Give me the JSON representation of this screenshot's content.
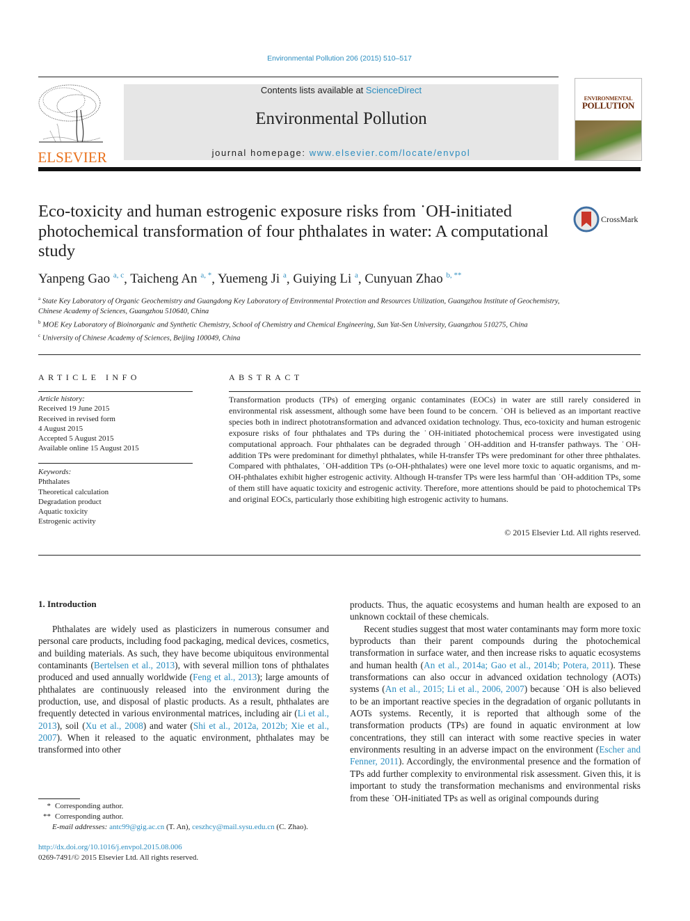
{
  "header": {
    "citation": "Environmental Pollution 206 (2015) 510–517",
    "contents_prefix": "Contents lists available at ",
    "contents_link": "ScienceDirect",
    "journal_title": "Environmental Pollution",
    "homepage_prefix": "journal homepage: ",
    "homepage_link": "www.elsevier.com/locate/envpol",
    "publisher_logo_text": "ELSEVIER",
    "cover_title_line1": "ENVIRONMENTAL",
    "cover_title_line2": "POLLUTION"
  },
  "article": {
    "title": "Eco-toxicity and human estrogenic exposure risks from ˙OH-initiated photochemical transformation of four phthalates in water: A computational study",
    "crossmark_label": "CrossMark",
    "authors": [
      {
        "name": "Yanpeng Gao",
        "sup": "a, c"
      },
      {
        "name": "Taicheng An",
        "sup": "a, *"
      },
      {
        "name": "Yuemeng Ji",
        "sup": "a"
      },
      {
        "name": "Guiying Li",
        "sup": "a"
      },
      {
        "name": "Cunyuan Zhao",
        "sup": "b, **"
      }
    ],
    "affiliations": [
      {
        "mark": "a",
        "text": "State Key Laboratory of Organic Geochemistry and Guangdong Key Laboratory of Environmental Protection and Resources Utilization, Guangzhou Institute of Geochemistry, Chinese Academy of Sciences, Guangzhou 510640, China"
      },
      {
        "mark": "b",
        "text": "MOE Key Laboratory of Bioinorganic and Synthetic Chemistry, School of Chemistry and Chemical Engineering, Sun Yat-Sen University, Guangzhou 510275, China"
      },
      {
        "mark": "c",
        "text": "University of Chinese Academy of Sciences, Beijing 100049, China"
      }
    ]
  },
  "article_info": {
    "heading": "ARTICLE INFO",
    "history_label": "Article history:",
    "history": [
      "Received 19 June 2015",
      "Received in revised form",
      "4 August 2015",
      "Accepted 5 August 2015",
      "Available online 15 August 2015"
    ],
    "keywords_label": "Keywords:",
    "keywords": [
      "Phthalates",
      "Theoretical calculation",
      "Degradation product",
      "Aquatic toxicity",
      "Estrogenic activity"
    ]
  },
  "abstract": {
    "heading": "ABSTRACT",
    "text": "Transformation products (TPs) of emerging organic contaminates (EOCs) in water are still rarely considered in environmental risk assessment, although some have been found to be concern. ˙OH is believed as an important reactive species both in indirect phototransformation and advanced oxidation technology. Thus, eco-toxicity and human estrogenic exposure risks of four phthalates and TPs during the ˙OH-initiated photochemical process were investigated using computational approach. Four phthalates can be degraded through ˙OH-addition and H-transfer pathways. The ˙OH-addition TPs were predominant for dimethyl phthalates, while H-transfer TPs were predominant for other three phthalates. Compared with phthalates, ˙OH-addition TPs (o-OH-phthalates) were one level more toxic to aquatic organisms, and m-OH-phthalates exhibit higher estrogenic activity. Although H-transfer TPs were less harmful than ˙OH-addition TPs, some of them still have aquatic toxicity and estrogenic activity. Therefore, more attentions should be paid to photochemical TPs and original EOCs, particularly those exhibiting high estrogenic activity to humans.",
    "copyright": "© 2015 Elsevier Ltd. All rights reserved."
  },
  "intro": {
    "heading": "1.  Introduction",
    "left_p1": [
      {
        "t": "Phthalates are widely used as plasticizers in numerous consumer and personal care products, including food packaging, medical devices, cosmetics, and building materials. As such, they have become ubiquitous environmental contaminants ("
      },
      {
        "l": "Bertelsen et al., 2013"
      },
      {
        "t": "), with several million tons of phthalates produced and used annually worldwide ("
      },
      {
        "l": "Feng et al., 2013"
      },
      {
        "t": "); large amounts of phthalates are continuously released into the environment during the production, use, and disposal of plastic products. As a result, phthalates are frequently detected in various environmental matrices, including air ("
      },
      {
        "l": "Li et al., 2013"
      },
      {
        "t": "), soil ("
      },
      {
        "l": "Xu et al., 2008"
      },
      {
        "t": ") and water ("
      },
      {
        "l": "Shi et al., 2012a, 2012b; Xie et al., 2007"
      },
      {
        "t": "). When it released to the aquatic environment, phthalates may be transformed into other"
      }
    ],
    "right_p1": [
      {
        "t": "products. Thus, the aquatic ecosystems and human health are exposed to an unknown cocktail of these chemicals."
      }
    ],
    "right_p2": [
      {
        "t": "Recent studies suggest that most water contaminants may form more toxic byproducts than their parent compounds during the photochemical transformation in surface water, and then increase risks to aquatic ecosystems and human health ("
      },
      {
        "l": "An et al., 2014a; Gao et al., 2014b; Potera, 2011"
      },
      {
        "t": "). These transformations can also occur in advanced oxidation technology (AOTs) systems ("
      },
      {
        "l": "An et al., 2015; Li et al., 2006, 2007"
      },
      {
        "t": ") because ˙OH is also believed to be an important reactive species in the degradation of organic pollutants in AOTs systems. Recently, it is reported that although some of the transformation products (TPs) are found in aquatic environment at low concentrations, they still can interact with some reactive species in water environments resulting in an adverse impact on the environment ("
      },
      {
        "l": "Escher and Fenner, 2011"
      },
      {
        "t": "). Accordingly, the environmental presence and the formation of TPs add further complexity to environmental risk assessment. Given this, it is important to study the transformation mechanisms and environmental risks from these ˙OH-initiated TPs as well as original compounds during"
      }
    ]
  },
  "footnotes": {
    "fn1_mark": "*",
    "fn1_text": "Corresponding author.",
    "fn2_mark": "**",
    "fn2_text": "Corresponding author.",
    "email_label": "E-mail addresses: ",
    "email1": "antc99@gig.ac.cn",
    "email1_owner": " (T. An), ",
    "email2": "ceszhcy@mail.sysu.edu.cn",
    "email2_owner": " (C. Zhao)."
  },
  "footer": {
    "doi": "http://dx.doi.org/10.1016/j.envpol.2015.08.006",
    "issn": "0269-7491/© 2015 Elsevier Ltd. All rights reserved."
  },
  "colors": {
    "link": "#2a8cbf",
    "elsevier_orange": "#e9711c",
    "journal_box_bg": "#e6e6e6"
  }
}
